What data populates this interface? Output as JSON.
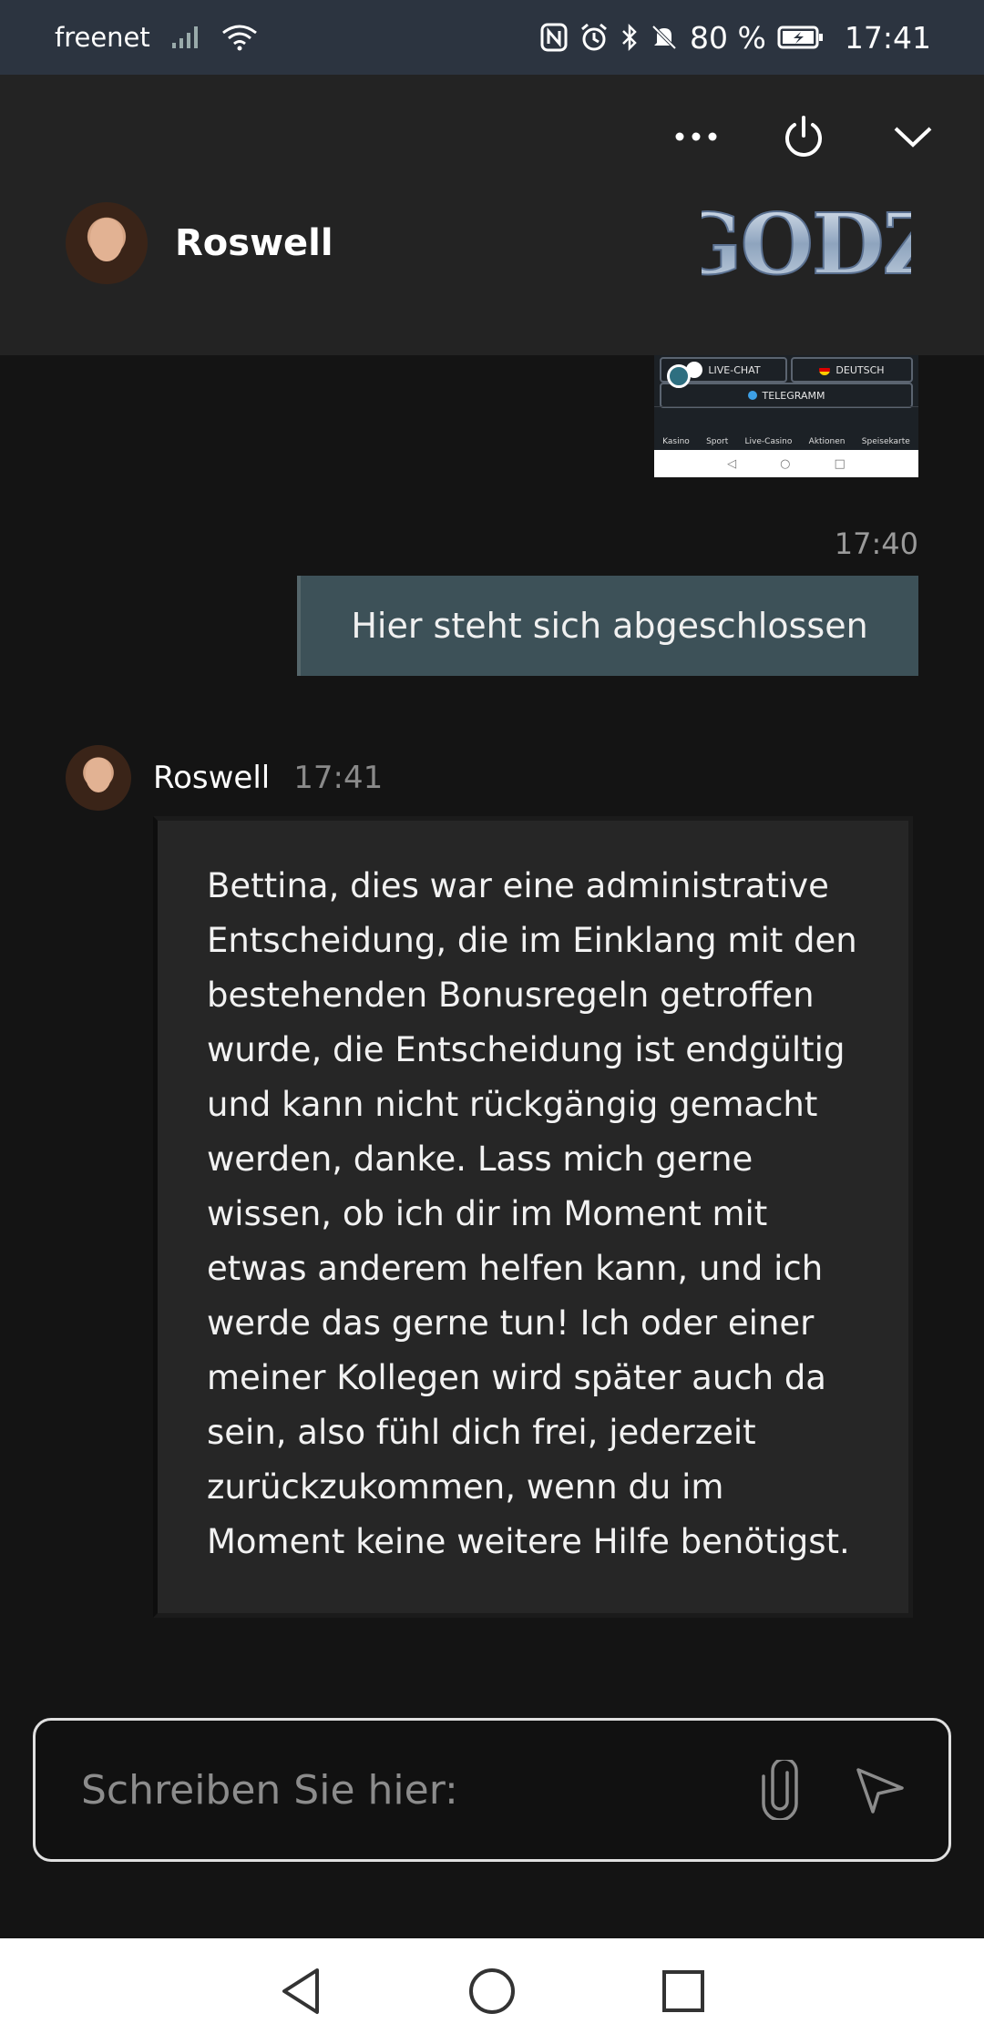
{
  "status_bar": {
    "carrier": "freenet",
    "battery": "80 %",
    "time": "17:41",
    "icons": [
      "signal-icon",
      "wifi-icon",
      "nfc-icon",
      "alarm-icon",
      "bluetooth-icon",
      "mute-icon",
      "battery-icon"
    ]
  },
  "header": {
    "agent_name": "Roswell",
    "logo_text": "GODZ",
    "icons": [
      "more-icon",
      "power-icon",
      "chevron-down-icon"
    ]
  },
  "chat": {
    "image_thumb": {
      "live_chat": "LIVE-CHAT",
      "language": "DEUTSCH",
      "telegram": "TELEGRAMM",
      "nav_items": [
        "Kasino",
        "Sport",
        "Live-Casino",
        "Aktionen",
        "Speisekarte"
      ]
    },
    "outgoing_time": "17:40",
    "outgoing_text": "Hier steht sich abgeschlossen",
    "incoming_name": "Roswell",
    "incoming_time": "17:41",
    "incoming_text": "Bettina, dies war eine administrative Entscheidung, die im Einklang mit den bestehenden Bonusregeln getroffen wurde, die Entscheidung ist endgültig und kann nicht rückgängig gemacht werden, danke. Lass mich gerne wissen, ob ich dir im Moment mit etwas anderem helfen kann, und ich werde das gerne tun! Ich oder einer meiner Kollegen wird später auch da sein, also fühl dich frei, jederzeit zurückzukommen, wenn du im Moment keine weitere Hilfe benötigst."
  },
  "composer": {
    "placeholder": "Schreiben Sie hier:",
    "value": "",
    "icons": [
      "paperclip-icon",
      "send-icon"
    ]
  },
  "system_nav": {
    "icons": [
      "back-icon",
      "home-icon",
      "recents-icon"
    ]
  },
  "colors": {
    "status_bar": "#2c3440",
    "header": "#232323",
    "background": "#141414",
    "outgoing_bubble": "#3d5158",
    "incoming_bubble": "#262626"
  }
}
